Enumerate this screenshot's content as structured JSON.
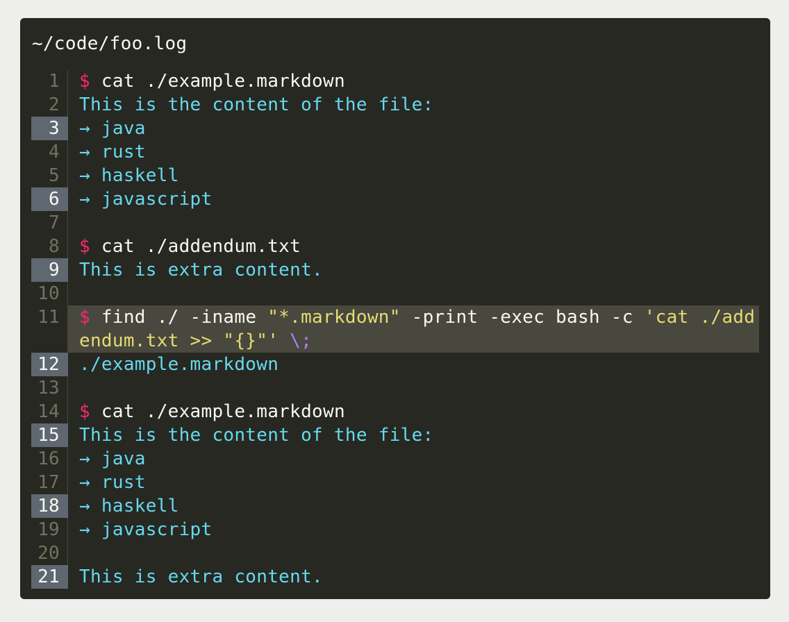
{
  "window": {
    "filename": "~/code/foo.log"
  },
  "lines": [
    {
      "n": "1",
      "hl": false,
      "sel": false,
      "segs": [
        {
          "t": "$ ",
          "c": "prompt"
        },
        {
          "t": "cat ./example.markdown",
          "c": "cmd"
        }
      ]
    },
    {
      "n": "2",
      "hl": false,
      "sel": false,
      "segs": [
        {
          "t": "This is the content of the file:",
          "c": "out"
        }
      ]
    },
    {
      "n": "3",
      "hl": true,
      "sel": false,
      "segs": [
        {
          "t": "→ java",
          "c": "out"
        }
      ]
    },
    {
      "n": "4",
      "hl": false,
      "sel": false,
      "segs": [
        {
          "t": "→ rust",
          "c": "out"
        }
      ]
    },
    {
      "n": "5",
      "hl": false,
      "sel": false,
      "segs": [
        {
          "t": "→ haskell",
          "c": "out"
        }
      ]
    },
    {
      "n": "6",
      "hl": true,
      "sel": false,
      "segs": [
        {
          "t": "→ javascript",
          "c": "out"
        }
      ]
    },
    {
      "n": "7",
      "hl": false,
      "sel": false,
      "segs": []
    },
    {
      "n": "8",
      "hl": false,
      "sel": false,
      "segs": [
        {
          "t": "$ ",
          "c": "prompt"
        },
        {
          "t": "cat ./addendum.txt",
          "c": "cmd"
        }
      ]
    },
    {
      "n": "9",
      "hl": true,
      "sel": false,
      "segs": [
        {
          "t": "This is extra content.",
          "c": "out"
        }
      ]
    },
    {
      "n": "10",
      "hl": false,
      "sel": false,
      "segs": []
    },
    {
      "n": "11",
      "hl": false,
      "sel": true,
      "segs": [
        {
          "t": "$ ",
          "c": "prompt"
        },
        {
          "t": "find ./ -iname ",
          "c": "cmd"
        },
        {
          "t": "\"*.markdown\"",
          "c": "str"
        },
        {
          "t": " -print -exec bash -c ",
          "c": "cmd"
        },
        {
          "t": "'cat ./addendum.txt >> \"{}\"'",
          "c": "str"
        },
        {
          "t": " ",
          "c": "cmd"
        },
        {
          "t": "\\;",
          "c": "esc"
        }
      ]
    },
    {
      "n": "12",
      "hl": true,
      "sel": false,
      "segs": [
        {
          "t": "./example.markdown",
          "c": "out"
        }
      ]
    },
    {
      "n": "13",
      "hl": false,
      "sel": false,
      "segs": []
    },
    {
      "n": "14",
      "hl": false,
      "sel": false,
      "segs": [
        {
          "t": "$ ",
          "c": "prompt"
        },
        {
          "t": "cat ./example.markdown",
          "c": "cmd"
        }
      ]
    },
    {
      "n": "15",
      "hl": true,
      "sel": false,
      "segs": [
        {
          "t": "This is the content of the file:",
          "c": "out"
        }
      ]
    },
    {
      "n": "16",
      "hl": false,
      "sel": false,
      "segs": [
        {
          "t": "→ java",
          "c": "out"
        }
      ]
    },
    {
      "n": "17",
      "hl": false,
      "sel": false,
      "segs": [
        {
          "t": "→ rust",
          "c": "out"
        }
      ]
    },
    {
      "n": "18",
      "hl": true,
      "sel": false,
      "segs": [
        {
          "t": "→ haskell",
          "c": "out"
        }
      ]
    },
    {
      "n": "19",
      "hl": false,
      "sel": false,
      "segs": [
        {
          "t": "→ javascript",
          "c": "out"
        }
      ]
    },
    {
      "n": "20",
      "hl": false,
      "sel": false,
      "segs": []
    },
    {
      "n": "21",
      "hl": true,
      "sel": false,
      "segs": [
        {
          "t": "This is extra content.",
          "c": "out"
        }
      ]
    }
  ],
  "colors": {
    "background": "#272822",
    "page": "#eeeeec",
    "prompt": "#f92672",
    "output": "#66d9ef",
    "string": "#e6db74",
    "escape": "#ae81ff",
    "text": "#f8f8f2",
    "line_highlight": "#5f6870",
    "selection": "#49483e"
  }
}
